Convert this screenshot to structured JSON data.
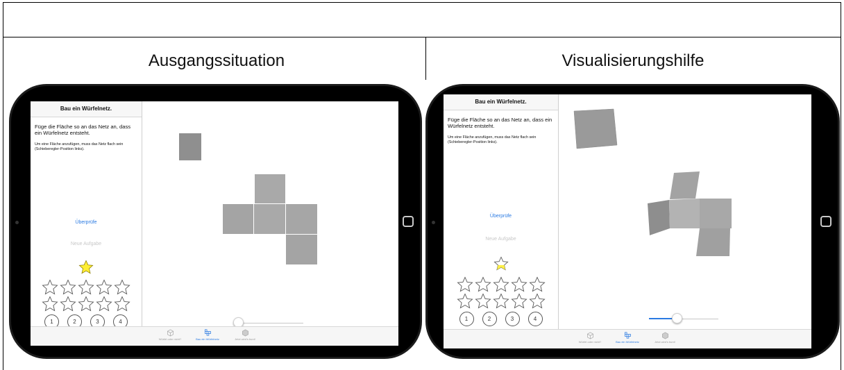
{
  "captions": {
    "left": "Ausgangssituation",
    "right": "Visualisierungshilfe"
  },
  "app": {
    "sidebar_title": "Bau ein Würfelnetz.",
    "instruction": "Füge die Fläche so an das Netz an, dass ein Würfelnetz entsteht.",
    "hint": "Um eine Fläche anzufügen, muss das Netz flach sein (Schieberegler-Position links).",
    "check_label": "Überprüfe",
    "new_task_label": "Neue Aufgabe",
    "level_buttons": [
      "1",
      "2",
      "3",
      "4"
    ],
    "tabs": [
      {
        "label": "Würfel oder nicht?",
        "icon": "cube-icon"
      },
      {
        "label": "Bau ein Würfelnetz",
        "icon": "cube-net-icon"
      },
      {
        "label": "Jetzt wird's bunt!",
        "icon": "colored-cube-icon"
      }
    ]
  },
  "screens": {
    "left": {
      "slider_level": 0,
      "highlight_star": "filled-yellow"
    },
    "right": {
      "slider_level": 0.4,
      "highlight_star": "outline-yellow"
    }
  },
  "colors": {
    "accent": "#2a7ae2",
    "star_yellow": "#ffee33",
    "face_gray": "#a6a6a6"
  }
}
